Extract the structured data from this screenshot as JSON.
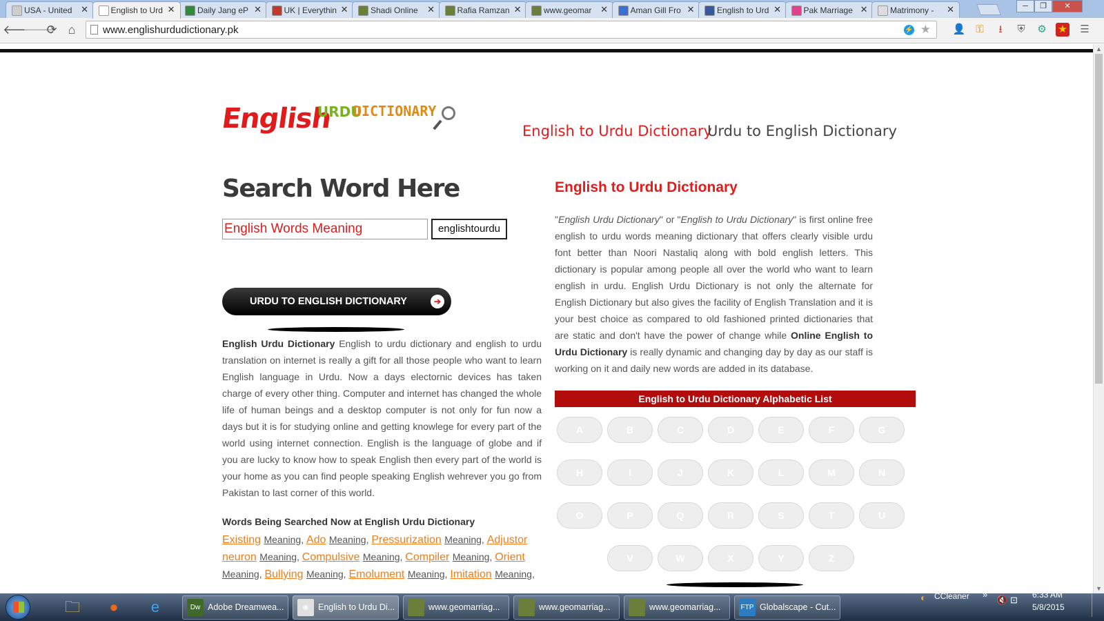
{
  "browser": {
    "tabs": [
      {
        "label": "USA - United",
        "icon_color": "#cccccc"
      },
      {
        "label": "English to Urd",
        "icon_color": "#ffffff",
        "active": true
      },
      {
        "label": "Daily Jang eP",
        "icon_color": "#2e8b3e"
      },
      {
        "label": "UK | Everythin",
        "icon_color": "#c0392b"
      },
      {
        "label": "Shadi Online",
        "icon_color": "#6b7f3a"
      },
      {
        "label": "Rafia Ramzan",
        "icon_color": "#6b7f3a"
      },
      {
        "label": "www.geomar",
        "icon_color": "#6b7f3a"
      },
      {
        "label": "Aman Gill Fro",
        "icon_color": "#3b6fd6"
      },
      {
        "label": "English to Urd",
        "icon_color": "#3b5998"
      },
      {
        "label": "Pak Marriage",
        "icon_color": "#e0418b"
      },
      {
        "label": "Matrimony - ",
        "icon_color": "#dddddd"
      }
    ],
    "tab_close_glyph": "✕",
    "url": "www.englishurdudictionary.pk",
    "nav_back": "🡐",
    "nav_forward": "🡒",
    "nav_reload": "⟳",
    "nav_home": "⌂",
    "window_minimize": "─",
    "window_restore": "❐",
    "window_close": "✕"
  },
  "page": {
    "logo": {
      "english": "English",
      "urdu": "URDU",
      "dictionary": "DICTIONARY"
    },
    "nav": {
      "english_to_urdu": "English to Urdu Dictionary",
      "urdu_to_english": "Urdu to English Dictionary"
    },
    "search": {
      "title": "Search Word Here",
      "input_value": "English Words Meaning",
      "button_label": "englishtourdu"
    },
    "urdu_button_label": "URDU TO ENGLISH DICTIONARY",
    "urdu_button_arrow": "➔",
    "left_text": {
      "bold_lead": "English Urdu Dictionary",
      "body": " English to urdu dictionary and english to urdu translation on internet is really a gift for all those people who want to learn English language in Urdu. Now a days electornic devices has taken charge of every other thing. Computer and internet has changed the whole life of human beings and a desktop computer is not only for fun now a days but it is for studying online and getting knowlege for every part of the world using internet connection. English is the language of globe and if you are lucky to know how to speak English then every part of the world is your home as you can find people speaking English wehrever you go from Pakistan to last corner of this world."
    },
    "words_heading": "Words Being Searched Now at English Urdu Dictionary",
    "meaning_label": "Meaning",
    "searched_words": [
      "Existing",
      "Ado",
      "Pressurization",
      "Adjustor neuron",
      "Compulsive",
      "Compiler",
      "Orient",
      "Bullying",
      "Emolument",
      "Imitation"
    ],
    "right_heading": "English to Urdu Dictionary",
    "right_text": {
      "q1": "English Urdu Dictionary",
      "q2": "English to Urdu Dictionary",
      "p1": "\"",
      "p2": "\" or \"",
      "p3": "\" is first online free english to urdu words meaning dictionary that offers clearly visible urdu font better than Noori Nastaliq along with bold english letters. This dictionary is popular among people all over the world who want to learn english in urdu. English Urdu Dictionary is not only the alternate for English Dictionary but also gives the facility of English Translation and it is your best choice as compared to old fashioned printed dictionaries that are static and don't have the power of change while ",
      "bold": "Online English to Urdu Dictionary",
      "p4": " is really dynamic and changing day by day as our staff is working on it and daily new words are added in its database."
    },
    "alphabet_heading": "English to Urdu Dictionary Alphabetic List",
    "letters": [
      "A",
      "B",
      "C",
      "D",
      "E",
      "F",
      "G",
      "H",
      "I",
      "J",
      "K",
      "L",
      "M",
      "N",
      "O",
      "P",
      "Q",
      "R",
      "S",
      "T",
      "U",
      "V",
      "W",
      "X",
      "Y",
      "Z"
    ]
  },
  "taskbar": {
    "pinned": [
      {
        "name": "explorer-icon",
        "glyph": "🗀",
        "color": "#e8c45a"
      },
      {
        "name": "firefox-icon",
        "glyph": "●",
        "color": "#e66a1a"
      },
      {
        "name": "ie-icon",
        "glyph": "e",
        "color": "#3da0e8"
      }
    ],
    "tasks": [
      {
        "label": "Adobe Dreamwea...",
        "icon_color": "#3f6a2a",
        "icon_text": "Dw"
      },
      {
        "label": "English to Urdu Di...",
        "icon_color": "#e0e0e0",
        "icon_text": "◉",
        "active": true
      },
      {
        "label": "www.geomarriag...",
        "icon_color": "#6b7f3a",
        "icon_text": ""
      },
      {
        "label": "www.geomarriag...",
        "icon_color": "#6b7f3a",
        "icon_text": ""
      },
      {
        "label": "www.geomarriag...",
        "icon_color": "#6b7f3a",
        "icon_text": ""
      },
      {
        "label": "Globalscape - Cut...",
        "icon_color": "#2c7cc4",
        "icon_text": "FTP"
      }
    ],
    "tray_app": "CCleaner",
    "time": "6:33 AM",
    "date": "5/8/2015"
  }
}
